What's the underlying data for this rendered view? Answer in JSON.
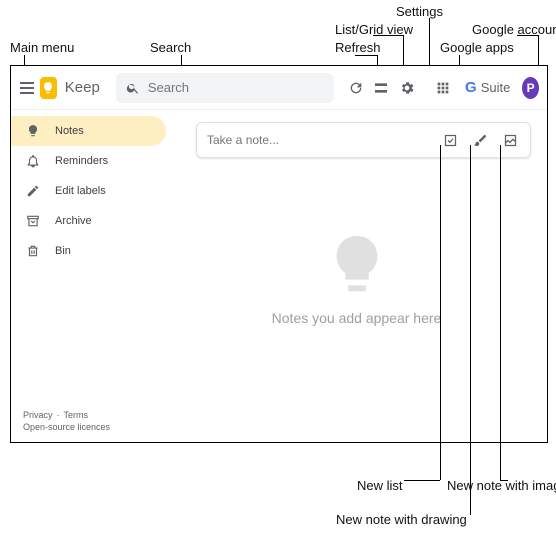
{
  "annotations": {
    "main_menu": "Main menu",
    "search": "Search",
    "refresh": "Refresh",
    "list_grid": "List/Grid view",
    "settings": "Settings",
    "google_apps": "Google apps",
    "google_account": "Google account",
    "new_list": "New list",
    "new_drawing": "New note with drawing",
    "new_image": "New note with image"
  },
  "brand": "Keep",
  "search": {
    "placeholder": "Search"
  },
  "gsuite": {
    "g": "G",
    "suite": "Suite"
  },
  "avatar_initial": "P",
  "sidebar": {
    "items": [
      {
        "label": "Notes"
      },
      {
        "label": "Reminders"
      },
      {
        "label": "Edit labels"
      },
      {
        "label": "Archive"
      },
      {
        "label": "Bin"
      }
    ]
  },
  "take_note": {
    "placeholder": "Take a note..."
  },
  "empty_state": "Notes you add appear here",
  "footer": {
    "privacy": "Privacy",
    "terms": "Terms",
    "licences": "Open-source licences"
  }
}
